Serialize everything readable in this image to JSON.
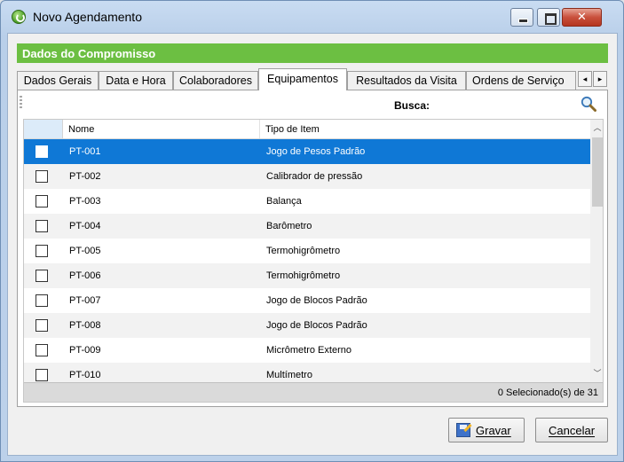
{
  "window": {
    "title": "Novo Agendamento"
  },
  "section": {
    "title": "Dados do Compromisso"
  },
  "tabs": [
    {
      "label": "Dados Gerais"
    },
    {
      "label": "Data e Hora"
    },
    {
      "label": "Colaboradores"
    },
    {
      "label": "Equipamentos",
      "active": true
    },
    {
      "label": "Resultados da Visita"
    },
    {
      "label": "Ordens de Serviço"
    }
  ],
  "tab_scroll": {
    "left": "◂",
    "right": "▸"
  },
  "search": {
    "label": "Busca:",
    "value": "",
    "placeholder": ""
  },
  "grid": {
    "columns": [
      "Nome",
      "Tipo de Item"
    ],
    "rows": [
      {
        "nome": "PT-001",
        "tipo": "Jogo de Pesos Padrão",
        "selected": true,
        "checked": false
      },
      {
        "nome": "PT-002",
        "tipo": "Calibrador de pressão",
        "checked": false
      },
      {
        "nome": "PT-003",
        "tipo": "Balança",
        "checked": false
      },
      {
        "nome": "PT-004",
        "tipo": "Barômetro",
        "checked": false
      },
      {
        "nome": "PT-005",
        "tipo": "Termohigrômetro",
        "checked": false
      },
      {
        "nome": "PT-006",
        "tipo": "Termohigrômetro",
        "checked": false
      },
      {
        "nome": "PT-007",
        "tipo": "Jogo de Blocos Padrão",
        "checked": false
      },
      {
        "nome": "PT-008",
        "tipo": "Jogo de Blocos Padrão",
        "checked": false
      },
      {
        "nome": "PT-009",
        "tipo": "Micrômetro Externo",
        "checked": false
      },
      {
        "nome": "PT-010",
        "tipo": "Multímetro",
        "checked": false
      }
    ],
    "footer": "0 Selecionado(s) de 31"
  },
  "buttons": {
    "save": "Gravar",
    "cancel": "Cancelar"
  },
  "colors": {
    "section_header": "#6cbf42",
    "selected_row": "#0f78d6"
  }
}
